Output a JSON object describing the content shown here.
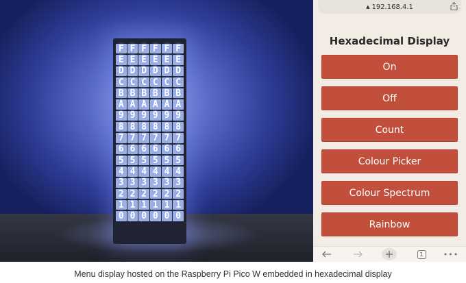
{
  "photo": {
    "display_rows": [
      "F",
      "E",
      "D",
      "C",
      "B",
      "A",
      "9",
      "8",
      "7",
      "6",
      "5",
      "4",
      "3",
      "2",
      "1",
      "0"
    ],
    "columns": 6
  },
  "browser": {
    "url": "192.168.4.1",
    "lock_icon": "lock-icon",
    "share_icon": "share-icon"
  },
  "page": {
    "title": "Hexadecimal Display",
    "buttons": [
      "On",
      "Off",
      "Count",
      "Colour Picker",
      "Colour Spectrum",
      "Rainbow"
    ],
    "button_color": "#c24f3c"
  },
  "navbar": {
    "back_icon": "back-arrow-icon",
    "forward_icon": "forward-arrow-icon",
    "new_tab_icon": "plus-icon",
    "tabs_count": "1",
    "more_icon": "more-dots-icon"
  },
  "caption": "Menu display hosted on the Raspberry Pi Pico W embedded in hexadecimal display"
}
